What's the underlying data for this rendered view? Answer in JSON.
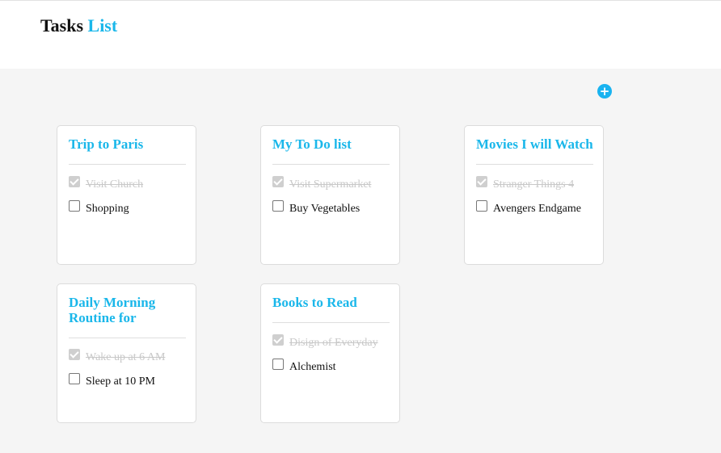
{
  "header": {
    "title": "Tasks",
    "title_accent": "List"
  },
  "add_button": {
    "label": "+",
    "icon": "plus-circle-icon"
  },
  "colors": {
    "accent": "#1ab7ea",
    "background": "#f5f5f5",
    "done_text": "#c8c8c8"
  },
  "lists": [
    {
      "title": "Trip to Paris",
      "tasks": [
        {
          "label": "Visit Church",
          "done": true
        },
        {
          "label": "Shopping",
          "done": false
        }
      ]
    },
    {
      "title": "My To Do list",
      "tasks": [
        {
          "label": "Visit Supermarket",
          "done": true
        },
        {
          "label": "Buy Vegetables",
          "done": false
        }
      ]
    },
    {
      "title": "Movies I will Watch",
      "tasks": [
        {
          "label": "Stranger Things 4",
          "done": true
        },
        {
          "label": "Avengers Endgame",
          "done": false
        }
      ]
    },
    {
      "title": "Daily Morning Routine for",
      "tasks": [
        {
          "label": "Wake up at 6 AM",
          "done": true
        },
        {
          "label": "Sleep at 10 PM",
          "done": false
        }
      ]
    },
    {
      "title": "Books to Read",
      "tasks": [
        {
          "label": "Disign of Everyday",
          "done": true
        },
        {
          "label": "Alchemist",
          "done": false
        }
      ]
    }
  ]
}
